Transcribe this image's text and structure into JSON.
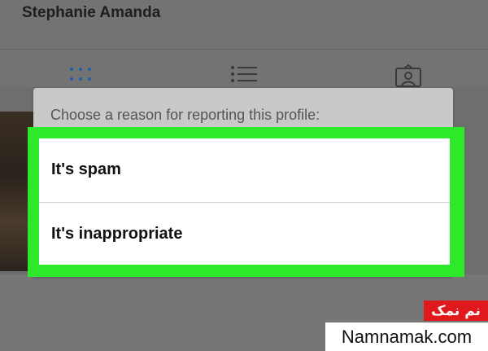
{
  "profile": {
    "name": "Stephanie Amanda"
  },
  "tabs": [
    {
      "icon": "grid-icon"
    },
    {
      "icon": "list-icon"
    },
    {
      "icon": "tagged-photos-icon"
    }
  ],
  "dialog": {
    "title": "Choose a reason for reporting this profile:",
    "options": [
      {
        "label": "It's spam"
      },
      {
        "label": "It's inappropriate"
      }
    ],
    "highlight_color": "#2ee82a"
  },
  "watermark": {
    "persian_text": "نم نمک",
    "site": "Namnamak.com"
  }
}
